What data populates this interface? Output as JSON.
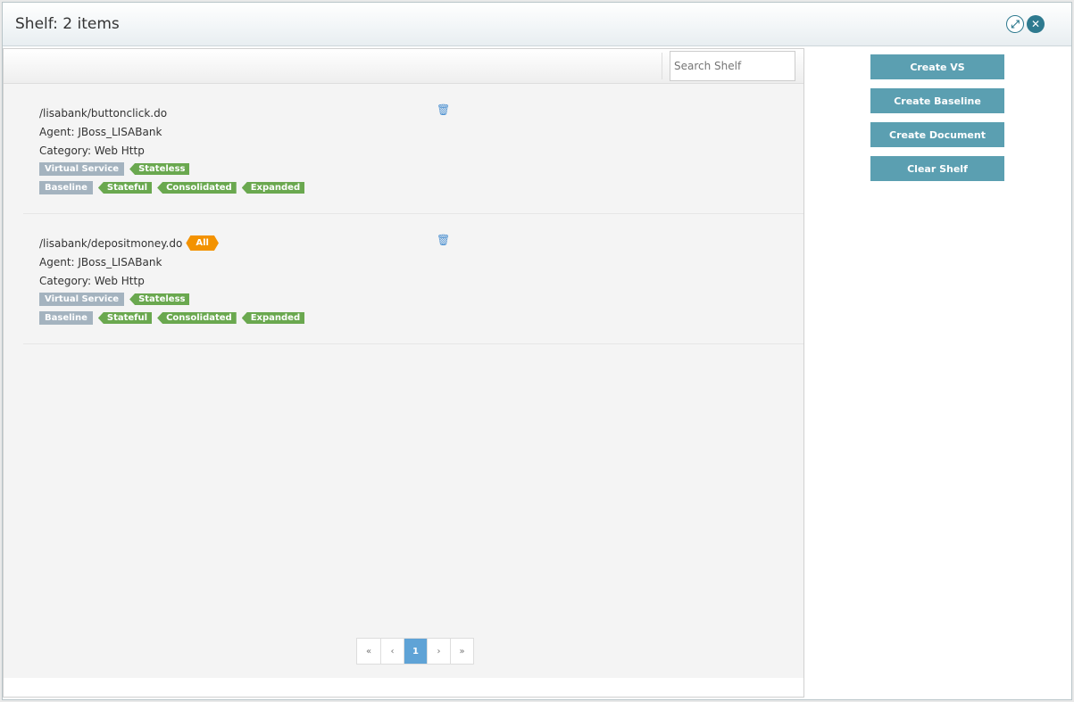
{
  "header": {
    "title": "Shelf: 2 items",
    "expand_icon": "expand-icon",
    "close_icon": "close-icon"
  },
  "search": {
    "placeholder": "Search Shelf"
  },
  "items": [
    {
      "path": "/lisabank/buttonclick.do",
      "agent": "Agent: JBoss_LISABank",
      "category": "Category: Web Http",
      "vs_label": "Virtual Service",
      "vs_tags": [
        "Stateless"
      ],
      "bl_label": "Baseline",
      "bl_tags": [
        "Stateful",
        "Consolidated",
        "Expanded"
      ]
    },
    {
      "path": "/lisabank/depositmoney.do",
      "badge": "All",
      "agent": "Agent: JBoss_LISABank",
      "category": "Category: Web Http",
      "vs_label": "Virtual Service",
      "vs_tags": [
        "Stateless"
      ],
      "bl_label": "Baseline",
      "bl_tags": [
        "Stateful",
        "Consolidated",
        "Expanded"
      ]
    }
  ],
  "pager": {
    "first": "«",
    "prev": "‹",
    "current": "1",
    "next": "›",
    "last": "»"
  },
  "actions": {
    "create_vs": "Create VS",
    "create_baseline": "Create Baseline",
    "create_document": "Create Document",
    "clear_shelf": "Clear Shelf"
  }
}
